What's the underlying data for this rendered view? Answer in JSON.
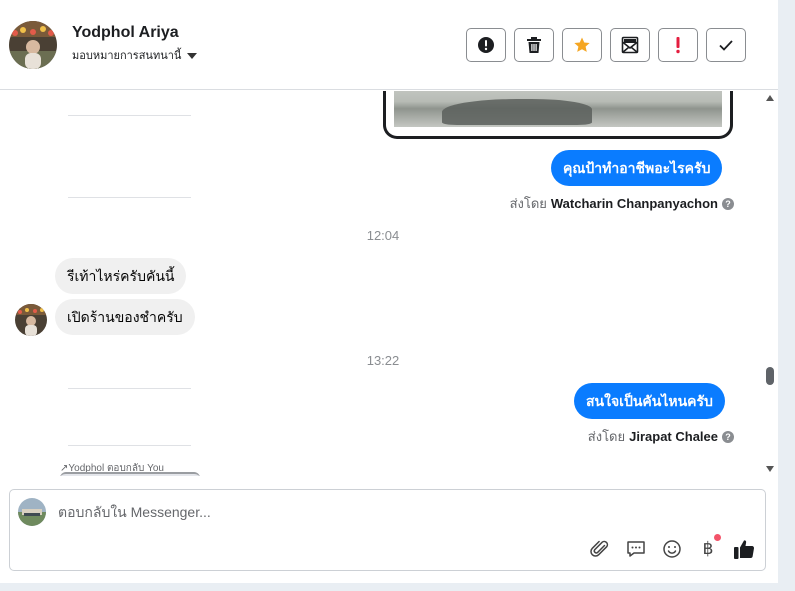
{
  "header": {
    "contact_name": "Yodphol Ariya",
    "assign_label": "มอบหมายการสนทนานี้",
    "actions": [
      {
        "name": "spam-button",
        "icon": "alert-circle-icon"
      },
      {
        "name": "delete-button",
        "icon": "trash-icon"
      },
      {
        "name": "star-button",
        "icon": "star-icon",
        "color": "#f5a623"
      },
      {
        "name": "mark-unread-button",
        "icon": "envelope-icon"
      },
      {
        "name": "follow-up-button",
        "icon": "exclamation-icon",
        "color": "#e41e3f"
      },
      {
        "name": "mark-done-button",
        "icon": "checkmark-icon"
      }
    ]
  },
  "chat": {
    "messages": [
      {
        "dir": "out",
        "text": "คุณป้าทำอาชีพอะไรครับ"
      },
      {
        "dir": "meta",
        "prefix": "ส่งโดย",
        "sender": "Watcharin Chanpanyachon"
      },
      {
        "dir": "time",
        "text": "12:04"
      },
      {
        "dir": "in",
        "text": "รีเท้าไหร่ครับคันนี้"
      },
      {
        "dir": "in",
        "text": "เปิดร้านของชำครับ"
      },
      {
        "dir": "time",
        "text": "13:22"
      },
      {
        "dir": "out",
        "text": "สนใจเป็นคันไหนครับ"
      },
      {
        "dir": "meta",
        "prefix": "ส่งโดย",
        "sender": "Jirapat Chalee"
      }
    ],
    "replied_note": "↗Yodphol ตอบกลับ You"
  },
  "composer": {
    "placeholder": "ตอบกลับใน Messenger...",
    "tools": [
      "paperclip-icon",
      "chat-bubble-icon",
      "smiley-icon",
      "baht-icon",
      "thumbs-up-icon"
    ],
    "baht_symbol": "฿"
  },
  "colors": {
    "accent": "#0a7cff",
    "star": "#f5a623",
    "alert": "#e41e3f",
    "badge": "#f35369"
  }
}
